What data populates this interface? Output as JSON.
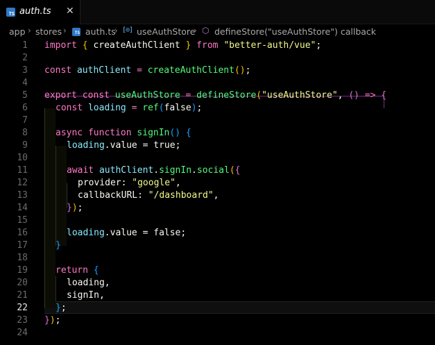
{
  "tab": {
    "filename": "auth.ts",
    "icon": "typescript-file-icon",
    "ts_badge": "TS",
    "close_glyph": "✕"
  },
  "breadcrumb": {
    "items": [
      "app",
      "stores",
      "auth.ts",
      "useAuthStore",
      "defineStore(\"useAuthStore\") callback"
    ],
    "variable_symbol": "[⊙]",
    "separator": "›"
  },
  "editor": {
    "active_line": 22,
    "line_numbers": [
      "1",
      "2",
      "3",
      "4",
      "5",
      "6",
      "7",
      "8",
      "9",
      "10",
      "11",
      "12",
      "13",
      "14",
      "15",
      "16",
      "17",
      "18",
      "19",
      "20",
      "21",
      "22",
      "23",
      "24"
    ],
    "code": {
      "l1": [
        "import",
        " ",
        "{",
        " createAuthClient ",
        "}",
        " from ",
        "\"better-auth/vue\"",
        ";"
      ],
      "l3": [
        "const",
        " ",
        "authClient",
        " = ",
        "createAuthClient",
        "(",
        ")",
        ";"
      ],
      "l5": [
        "export",
        " ",
        "const",
        " ",
        "useAuthStore",
        " = ",
        "defineStore",
        "(",
        "\"useAuthStore\"",
        ", ",
        "(",
        ")",
        " => ",
        "{"
      ],
      "l6": [
        "const",
        " ",
        "loading",
        " = ",
        "ref",
        "(",
        "false",
        ")",
        ";"
      ],
      "l8": [
        "async",
        " ",
        "function",
        " ",
        "signIn",
        "(",
        ")",
        " ",
        "{"
      ],
      "l9": [
        "loading",
        ".value = ",
        "true",
        ";"
      ],
      "l11": [
        "await",
        " ",
        "authClient",
        ".",
        "signIn",
        ".",
        "social",
        "(",
        "{"
      ],
      "l12": [
        "provider: ",
        "\"google\"",
        ","
      ],
      "l13": [
        "callbackURL: ",
        "\"/dashboard\"",
        ","
      ],
      "l14": [
        "}",
        ")",
        ";"
      ],
      "l16": [
        "loading",
        ".value = ",
        "false",
        ";"
      ],
      "l17": [
        "}"
      ],
      "l19": [
        "return",
        " ",
        "{"
      ],
      "l20": [
        "loading,"
      ],
      "l21": [
        "signIn,"
      ],
      "l22": [
        "}",
        ";"
      ],
      "l23": [
        "}",
        ")",
        ";"
      ]
    }
  },
  "colors": {
    "background": "#000000",
    "keyword": "#ff79c6",
    "function": "#50fa7b",
    "string": "#f1fa8c",
    "variable": "#8be9fd",
    "bracket_gold": "#f0c000",
    "bracket_purple": "#da70d6",
    "bracket_blue": "#179fff"
  }
}
